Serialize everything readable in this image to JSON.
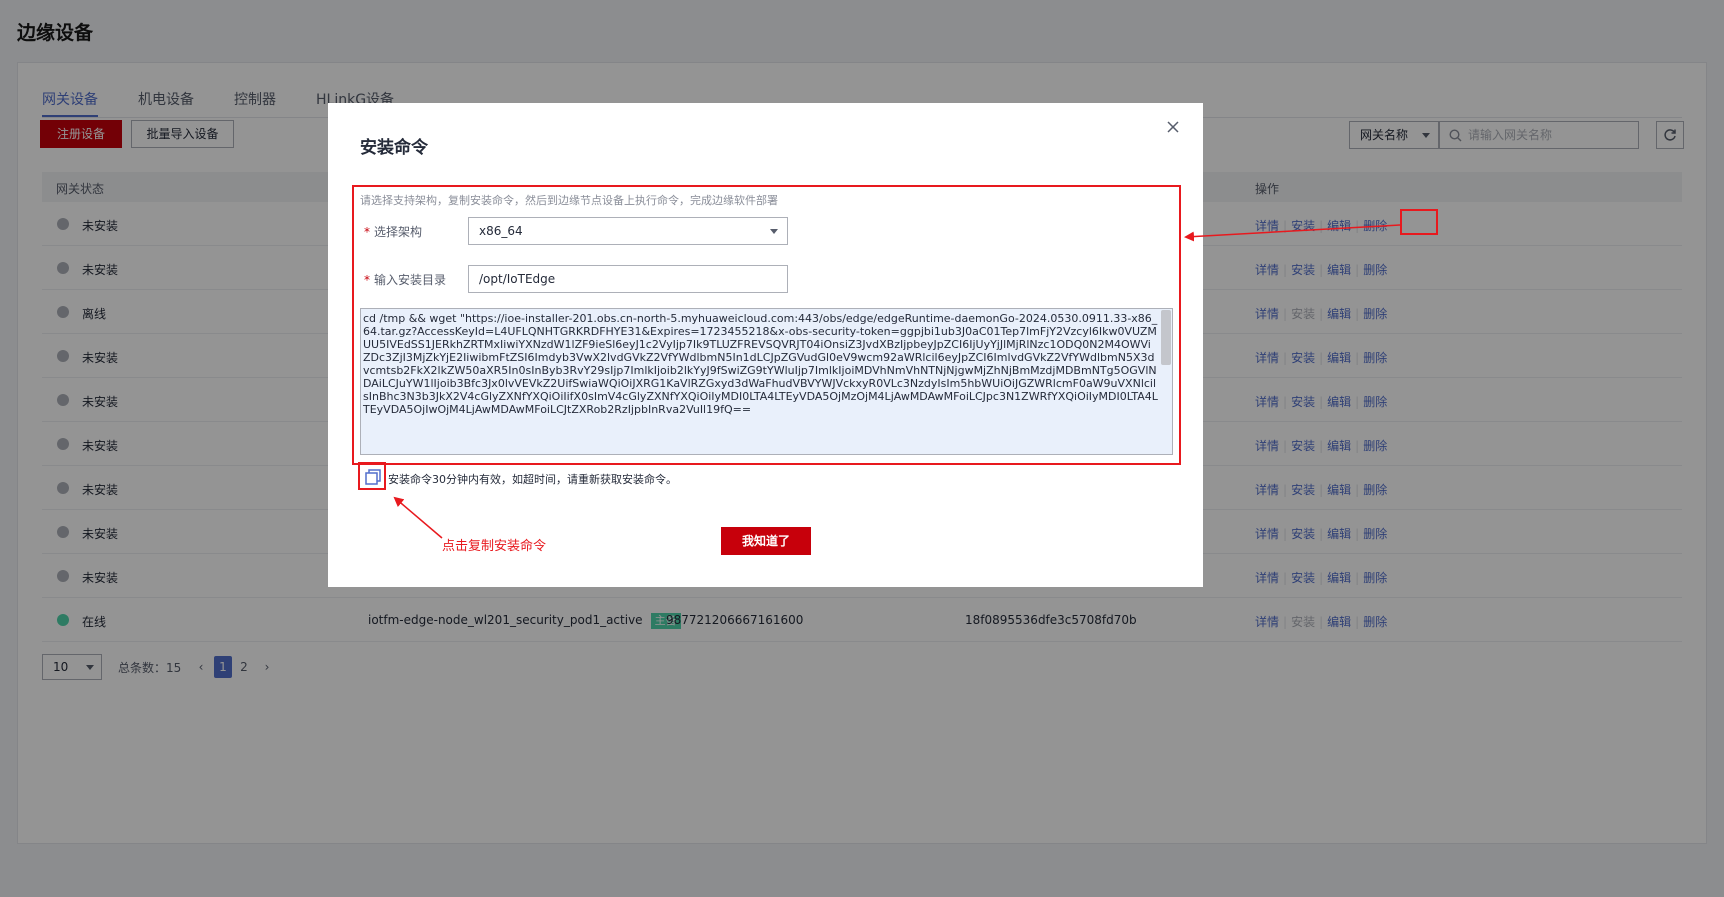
{
  "page": {
    "title": "边缘设备"
  },
  "tabs": [
    {
      "label": "网关设备"
    },
    {
      "label": "机电设备"
    },
    {
      "label": "控制器"
    },
    {
      "label": "HLinkG设备"
    }
  ],
  "toolbar": {
    "register_label": "注册设备",
    "import_label": "批量导入设备",
    "filter_select": "网关名称",
    "search_placeholder": "请输入网关名称"
  },
  "table": {
    "headers": {
      "status": "网关状态",
      "ops": "操作"
    },
    "rows": [
      {
        "status": "未安装",
        "install_enabled": true
      },
      {
        "status": "未安装",
        "install_enabled": true
      },
      {
        "status": "离线",
        "install_enabled": false
      },
      {
        "status": "未安装",
        "install_enabled": true
      },
      {
        "status": "未安装",
        "install_enabled": true
      },
      {
        "status": "未安装",
        "install_enabled": true
      },
      {
        "status": "未安装",
        "install_enabled": true
      },
      {
        "status": "未安装",
        "install_enabled": true
      },
      {
        "status": "未安装",
        "install_enabled": true
      },
      {
        "status": "在线",
        "install_enabled": false,
        "name": "iotfm-edge-node_wl201_security_pod1_active",
        "tag": "主备",
        "id": "987721206667161600",
        "hash": "18f0895536dfe3c5708fd70b"
      }
    ],
    "ops": {
      "detail": "详情",
      "install": "安装",
      "edit": "编辑",
      "delete": "删除"
    }
  },
  "pagination": {
    "page_size": "10",
    "total": "总条数：15",
    "pages": [
      "1",
      "2"
    ],
    "current": "1"
  },
  "dialog": {
    "title": "安装命令",
    "hint": "请选择支持架构，复制安装命令，然后到边缘节点设备上执行命令，完成边缘软件部署",
    "arch_label": "选择架构",
    "arch_value": "x86_64",
    "dir_label": "输入安装目录",
    "dir_value": "/opt/IoTEdge",
    "command": "cd /tmp && wget \"https://ioe-installer-201.obs.cn-north-5.myhuaweicloud.com:443/obs/edge/edgeRuntime-daemonGo-2024.0530.0911.33-x86_64.tar.gz?AccessKeyId=L4UFLQNHTGRKRDFHYE31&Expires=1723455218&x-obs-security-token=ggpjbi1ub3J0aC01Tep7lmFjY2Vzcyl6Ikw0VUZMUU5IVEdSS1JERkhZRTMxIiwiYXNzdW1lZF9ieSl6eyJ1c2VyIjp7Ik9TLUZFREVSQVRJT04iOnsiZ3JvdXBzIjpbeyJpZCI6IjUyYjJlMjRlNzc1ODQ0N2M4OWViZDc3ZjI3MjZkYjE2IiwibmFtZSI6Imdyb3VwX2lvdGVkZ2VfYWdlbmN5In1dLCJpZGVudGl0eV9wcm92aWRlcil6eyJpZCI6ImlvdGVkZ2VfYWdlbmN5X3dvcmtsb2FkX2lkZW50aXR5In0sInByb3RvY29sIjp7ImlkIjoib2lkYyJ9fSwiZG9tYWluIjp7ImlkIjoiMDVhNmVhNTNjNjgwMjZhNjBmMzdjMDBmNTg5OGVlNDAiLCJuYW1lIjoib3Bfc3Jx0lvVEVkZ2UifSwiaWQiOiJXRG1KaVlRZGxyd3dWaFhudVBVYWJVckxyR0VLc3NzdyIsIm5hbWUiOiJGZWRlcmF0aW9uVXNlcilsInBhc3N3b3JkX2V4cGlyZXNfYXQiOiIifX0sImV4cGlyZXNfYXQiOiIyMDI0LTA4LTEyVDA5OjMzOjM4LjAwMDAwMFoiLCJpc3N1ZWRfYXQiOiIyMDI0LTA4LTEyVDA5OjIwOjM4LjAwMDAwMFoiLCJtZXRob2RzIjpbInRva2VuIl19fQ==",
    "valid_note": "安装命令30分钟内有效，如超时间，请重新获取安装命令。",
    "annotation": "点击复制安装命令",
    "ok_label": "我知道了"
  },
  "colors": {
    "accent": "#526ecc",
    "primary": "#c7000b",
    "annotation": "#e8191e",
    "online": "#50d4ab",
    "offline": "#adb0b8"
  },
  "icons": {
    "close": "close-icon",
    "copy": "copy-icon",
    "refresh": "refresh-icon",
    "search": "search-icon"
  }
}
